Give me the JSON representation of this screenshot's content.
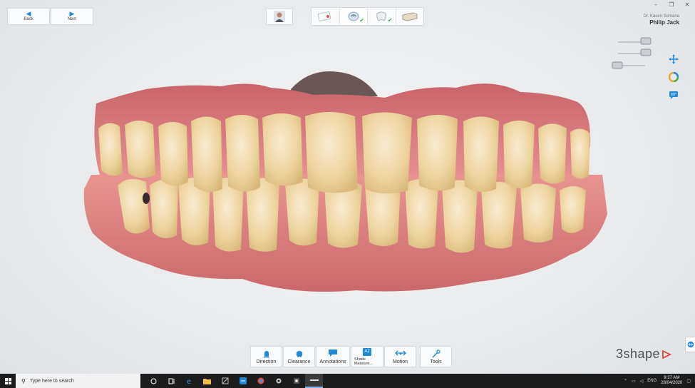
{
  "window_controls": [
    "–",
    "❐",
    "✕"
  ],
  "nav": {
    "back_label": "Back",
    "next_label": "Next"
  },
  "user": {
    "doctor": "Dr. Kasen Somana",
    "patient": "Philip Jack"
  },
  "workflow": {
    "steps": [
      {
        "icon": "prescription-icon",
        "done": false
      },
      {
        "icon": "scan-icon",
        "done": true,
        "active": true
      },
      {
        "icon": "tooth-icon",
        "done": true
      },
      {
        "icon": "model-icon",
        "done": false
      }
    ],
    "check_glyph": "✔"
  },
  "toolbar": {
    "items": [
      {
        "label": "Direction",
        "icon": "direction-icon"
      },
      {
        "label": "Clearance",
        "icon": "clearance-icon"
      },
      {
        "label": "Annotations",
        "icon": "annotations-icon"
      },
      {
        "label": "Shade Measure...",
        "icon": "shade-measure-icon",
        "badge": "A2"
      },
      {
        "label": "Motion",
        "icon": "motion-icon"
      },
      {
        "label": "Tools",
        "icon": "tools-icon"
      }
    ]
  },
  "brand": {
    "name": "3shape"
  },
  "taskbar": {
    "search_placeholder": "Type here to search",
    "language": "ENG",
    "time": "9:37 AM",
    "date": "28/04/2020"
  },
  "colors": {
    "accent": "#1f8ad8",
    "check": "#2bb34a",
    "brand_red": "#e0463a"
  }
}
